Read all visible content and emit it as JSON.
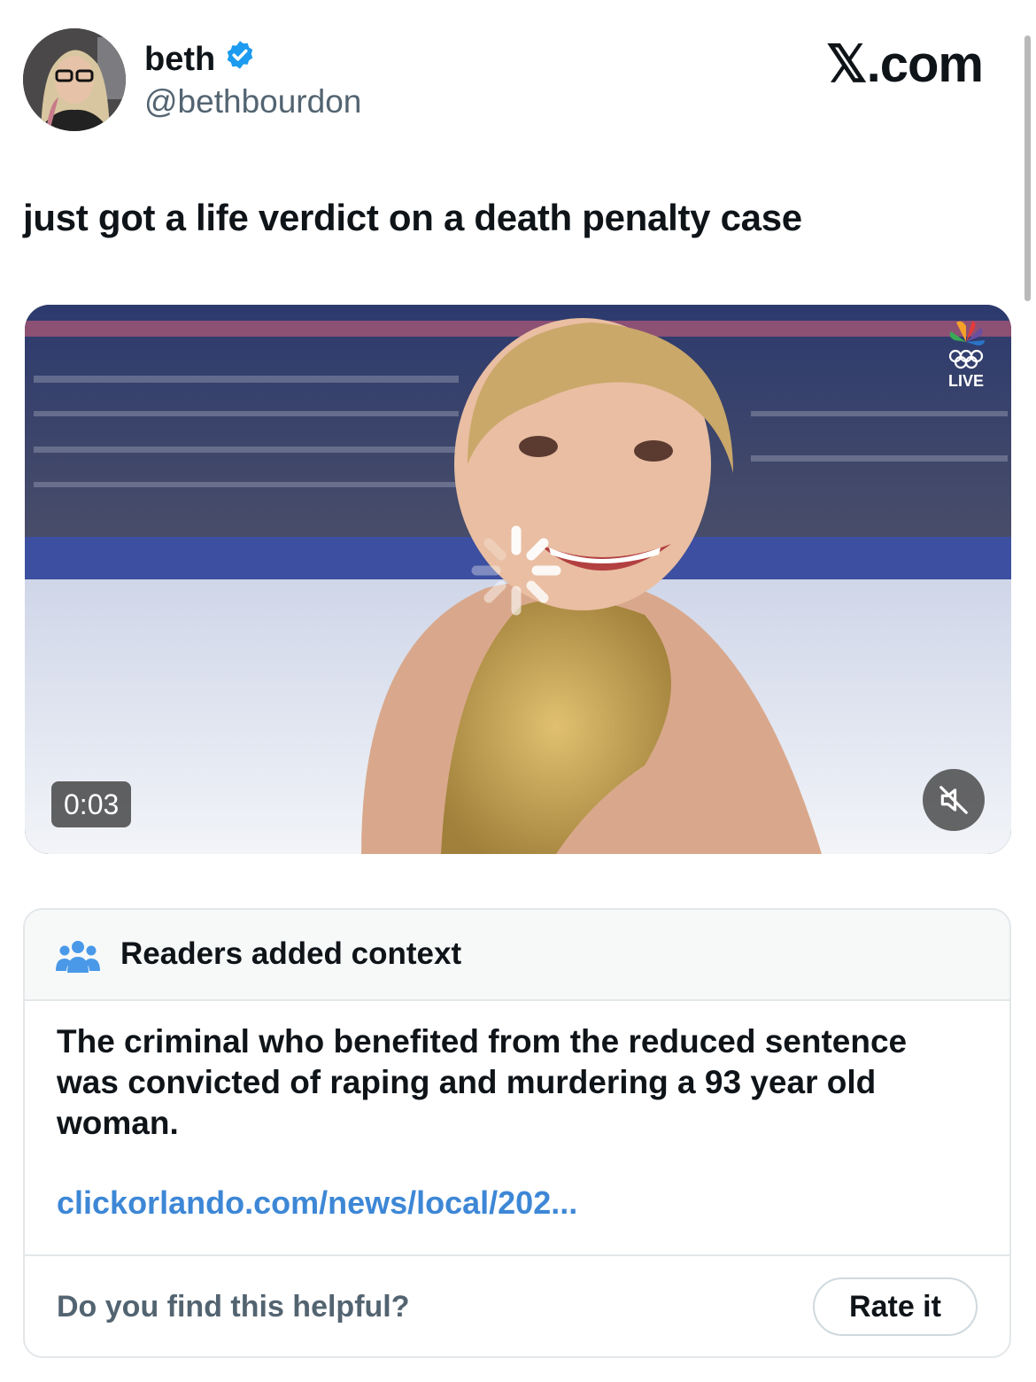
{
  "author": {
    "name": "beth",
    "handle": "@bethbourdon",
    "verified": true
  },
  "brand": "𝕏.com",
  "tweet": {
    "text": "just got a life verdict on a death penalty case"
  },
  "media": {
    "timestamp": "0:03",
    "live_label": "LIVE",
    "icons": [
      "olympic-rings-icon",
      "peacock-logo-icon",
      "loading-spinner-icon",
      "muted-speaker-icon"
    ]
  },
  "context_note": {
    "title": "Readers added context",
    "body": "The criminal who benefited from the reduced sentence was convicted of raping and murdering a 93 year old woman.",
    "link": "clickorlando.com/news/local/202...",
    "helpful_question": "Do you find this helpful?",
    "rate_button": "Rate it"
  },
  "colors": {
    "text": "#0f1419",
    "secondary": "#536471",
    "link": "#3d87d6",
    "verified": "#1d9bf0",
    "note_bg": "#f7f9f9"
  }
}
